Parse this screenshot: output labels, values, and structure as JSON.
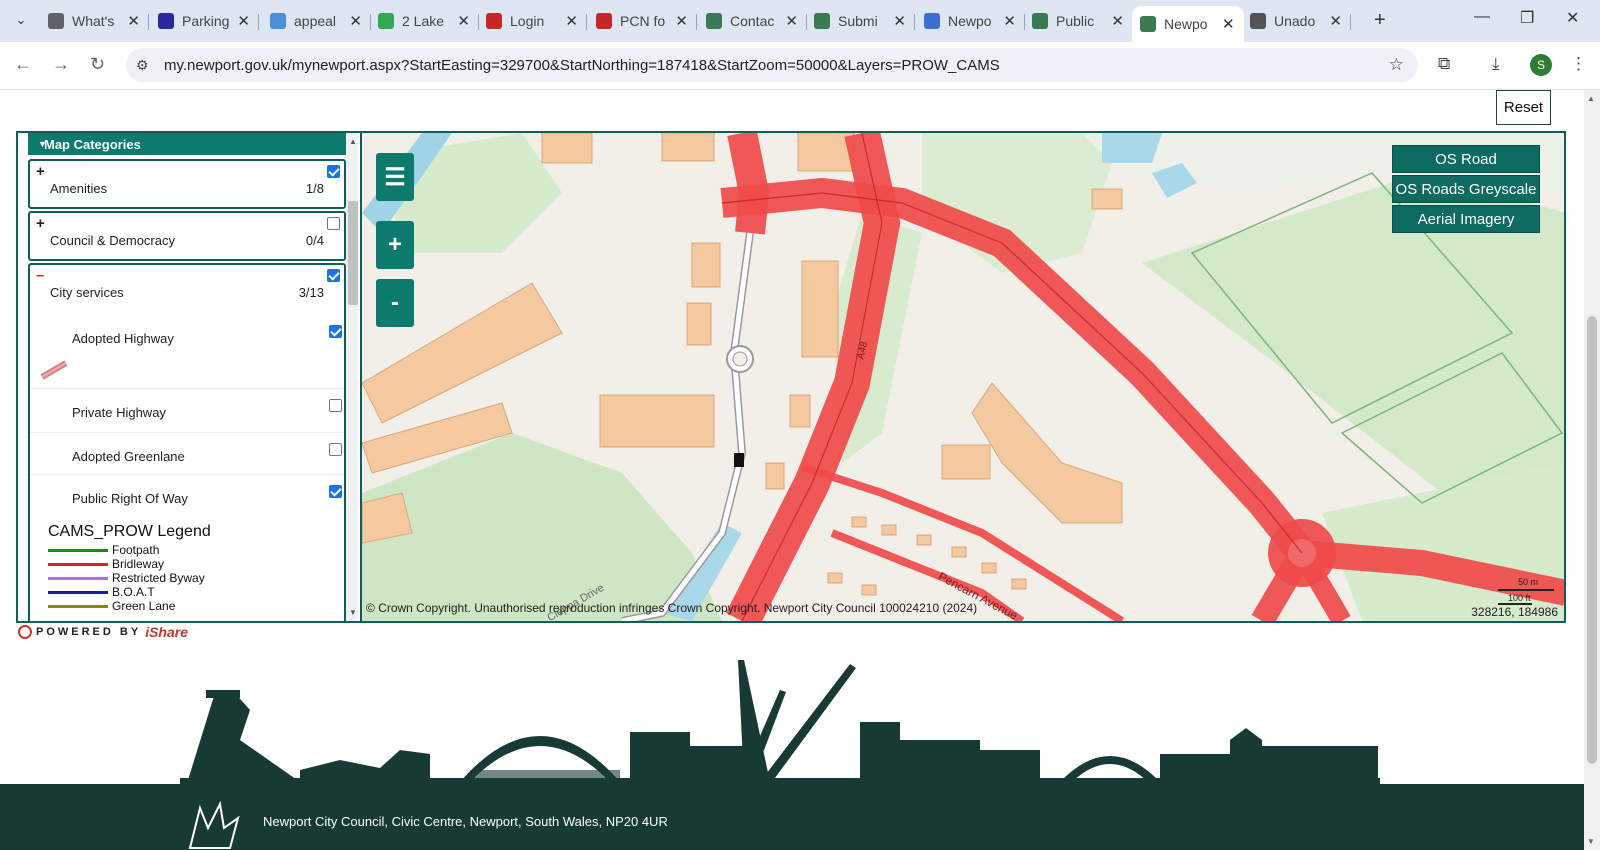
{
  "browser": {
    "tabs": [
      {
        "title": "What's",
        "fav_color": "#5f6368",
        "fav": "chrome-icon"
      },
      {
        "title": "Parking",
        "fav_color": "#2a2aa0",
        "fav": "cpm-icon"
      },
      {
        "title": "appeal",
        "fav_color": "#4a90d9",
        "fav": "globe-icon"
      },
      {
        "title": "2 Lake",
        "fav_color": "#34a853",
        "fav": "maps-pin-icon"
      },
      {
        "title": "Login",
        "fav_color": "#c62828",
        "fav": "mse-icon"
      },
      {
        "title": "PCN fo",
        "fav_color": "#c62828",
        "fav": "mse-icon"
      },
      {
        "title": "Contac",
        "fav_color": "#3a7a55",
        "fav": "newport-icon"
      },
      {
        "title": "Submi",
        "fav_color": "#3a7a55",
        "fav": "newport-icon"
      },
      {
        "title": "Newpo",
        "fav_color": "#3b6fd4",
        "fav": "people-icon"
      },
      {
        "title": "Public",
        "fav_color": "#3a7a55",
        "fav": "newport-icon"
      },
      {
        "title": "Newpo",
        "fav_color": "#3a7a55",
        "fav": "newport-icon",
        "active": true
      },
      {
        "title": "Unado",
        "fav_color": "#555555",
        "fav": "spider-icon"
      }
    ],
    "url": "my.newport.gov.uk/mynewport.aspx?StartEasting=329700&StartNorthing=187418&StartZoom=50000&Layers=PROW_CAMS",
    "avatar_letter": "S"
  },
  "page": {
    "reset_label": "Reset",
    "map_categories_title": "Map Categories",
    "categories": [
      {
        "label": "Amenities",
        "count": "1/8",
        "expanded": false,
        "checked": true
      },
      {
        "label": "Council & Democracy",
        "count": "0/4",
        "expanded": false,
        "checked": false
      },
      {
        "label": "City services",
        "count": "3/13",
        "expanded": true,
        "checked": true
      }
    ],
    "sub_items": [
      {
        "label": "Adopted Highway",
        "checked": true
      },
      {
        "label": "Private Highway",
        "checked": false
      },
      {
        "label": "Adopted Greenlane",
        "checked": false
      },
      {
        "label": "Public Right Of Way",
        "checked": true
      }
    ],
    "legend": {
      "title": "CAMS_PROW Legend",
      "items": [
        {
          "label": "Footpath",
          "color": "#1e8a1e"
        },
        {
          "label": "Bridleway",
          "color": "#e02020"
        },
        {
          "label": "Restricted Byway",
          "color": "#b070e0"
        },
        {
          "label": "B.O.A.T",
          "color": "#1a1aa8"
        },
        {
          "label": "Green Lane",
          "color": "#8a8a10"
        }
      ]
    },
    "map": {
      "base_layers": [
        "OS Road",
        "OS Roads Greyscale",
        "Aerial Imagery"
      ],
      "copyright": "© Crown Copyright. Unauthorised reproduction infringes Crown Copyright. Newport City Council 100024210 (2024)",
      "coords": "328216, 184986",
      "scale_m": "50 m",
      "scale_ft": "100 ft",
      "road_label": "A48",
      "street_1": "Pencarn Avenue",
      "street_2": "Cleppa Drive"
    },
    "powered_text": "POWERED BY",
    "powered_brand": "iShare",
    "footer_address": "Newport City Council, Civic Centre, Newport, South Wales, NP20 4UR"
  },
  "colors": {
    "teal": "#0d7a6e",
    "footer": "#173b34",
    "road": "#f04a4a"
  }
}
